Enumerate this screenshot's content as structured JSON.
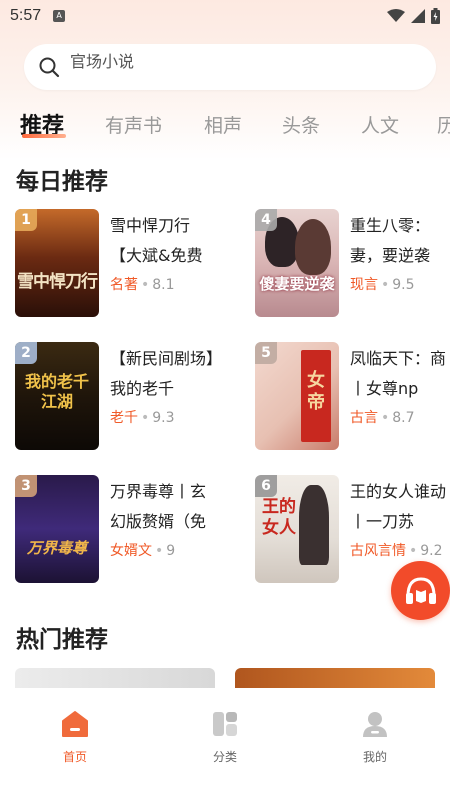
{
  "status": {
    "time": "5:57",
    "notif_letter": "A"
  },
  "search": {
    "placeholder": "官场小说"
  },
  "tabs": [
    {
      "label": "推荐",
      "active": true
    },
    {
      "label": "有声书"
    },
    {
      "label": "相声"
    },
    {
      "label": "头条"
    },
    {
      "label": "人文"
    },
    {
      "label": "历"
    }
  ],
  "daily": {
    "title": "每日推荐",
    "books": [
      {
        "rank": "1",
        "title": "雪中悍刀行【大斌&免费",
        "genre": "名著",
        "score": "8.1",
        "cover_text": "雪中悍刀行"
      },
      {
        "rank": "4",
        "title": "重生八零：妻，要逆袭",
        "genre": "现言",
        "score": "9.5",
        "cover_text": "傻妻要逆袭"
      },
      {
        "rank": "2",
        "title": "【新民间剧场】我的老千",
        "genre": "老千",
        "score": "9.3",
        "cover_text": "我的老千江湖"
      },
      {
        "rank": "5",
        "title": "凤临天下：商丨女尊np",
        "genre": "古言",
        "score": "8.7",
        "cover_text": "女帝"
      },
      {
        "rank": "3",
        "title": "万界毒尊丨玄幻版赘婿（免",
        "genre": "女婿文",
        "score": "9",
        "cover_text": "万界毒尊"
      },
      {
        "rank": "6",
        "title": "王的女人谁动丨一刀苏",
        "genre": "古风言情",
        "score": "9.2",
        "cover_text": "王的女人"
      }
    ]
  },
  "hot": {
    "title": "热门推荐"
  },
  "nav": [
    {
      "label": "首页",
      "icon": "home-icon",
      "active": true
    },
    {
      "label": "分类",
      "icon": "category-icon"
    },
    {
      "label": "我的",
      "icon": "profile-icon"
    }
  ],
  "colors": {
    "accent": "#f05a28",
    "fab": "#f24b2a"
  }
}
